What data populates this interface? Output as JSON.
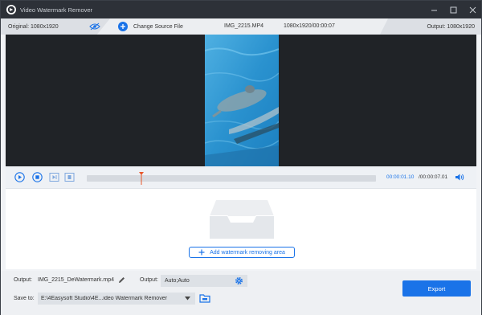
{
  "window": {
    "title": "Video Watermark Remover",
    "controls": [
      "minimize-icon",
      "maximize-icon",
      "close-icon"
    ]
  },
  "infobar": {
    "original_label": "Original: 1080x1920",
    "change_source_label": "Change Source File",
    "file_name": "IMG_2215.MP4",
    "file_meta": "1080x1920/00:00:07",
    "output_label": "Output: 1080x1920"
  },
  "player": {
    "current_time": "00:00:01.10",
    "total_time": "/00:00:07.01",
    "progress": 0.19
  },
  "watermark": {
    "add_area_label": "Add watermark removing area"
  },
  "bottom": {
    "output_label": "Output:",
    "output_file": "IMG_2215_DeWatermark.mp4",
    "format_label": "Output:",
    "format_value": "Auto;Auto",
    "save_label": "Save to:",
    "save_path": "E:\\4Easysoft Studio\\4E...ideo Watermark Remover",
    "export_label": "Export"
  },
  "colors": {
    "accent": "#1a73e8",
    "titlebar": "#2d3138",
    "preview_bg": "#202327",
    "playhead": "#e8572a"
  }
}
